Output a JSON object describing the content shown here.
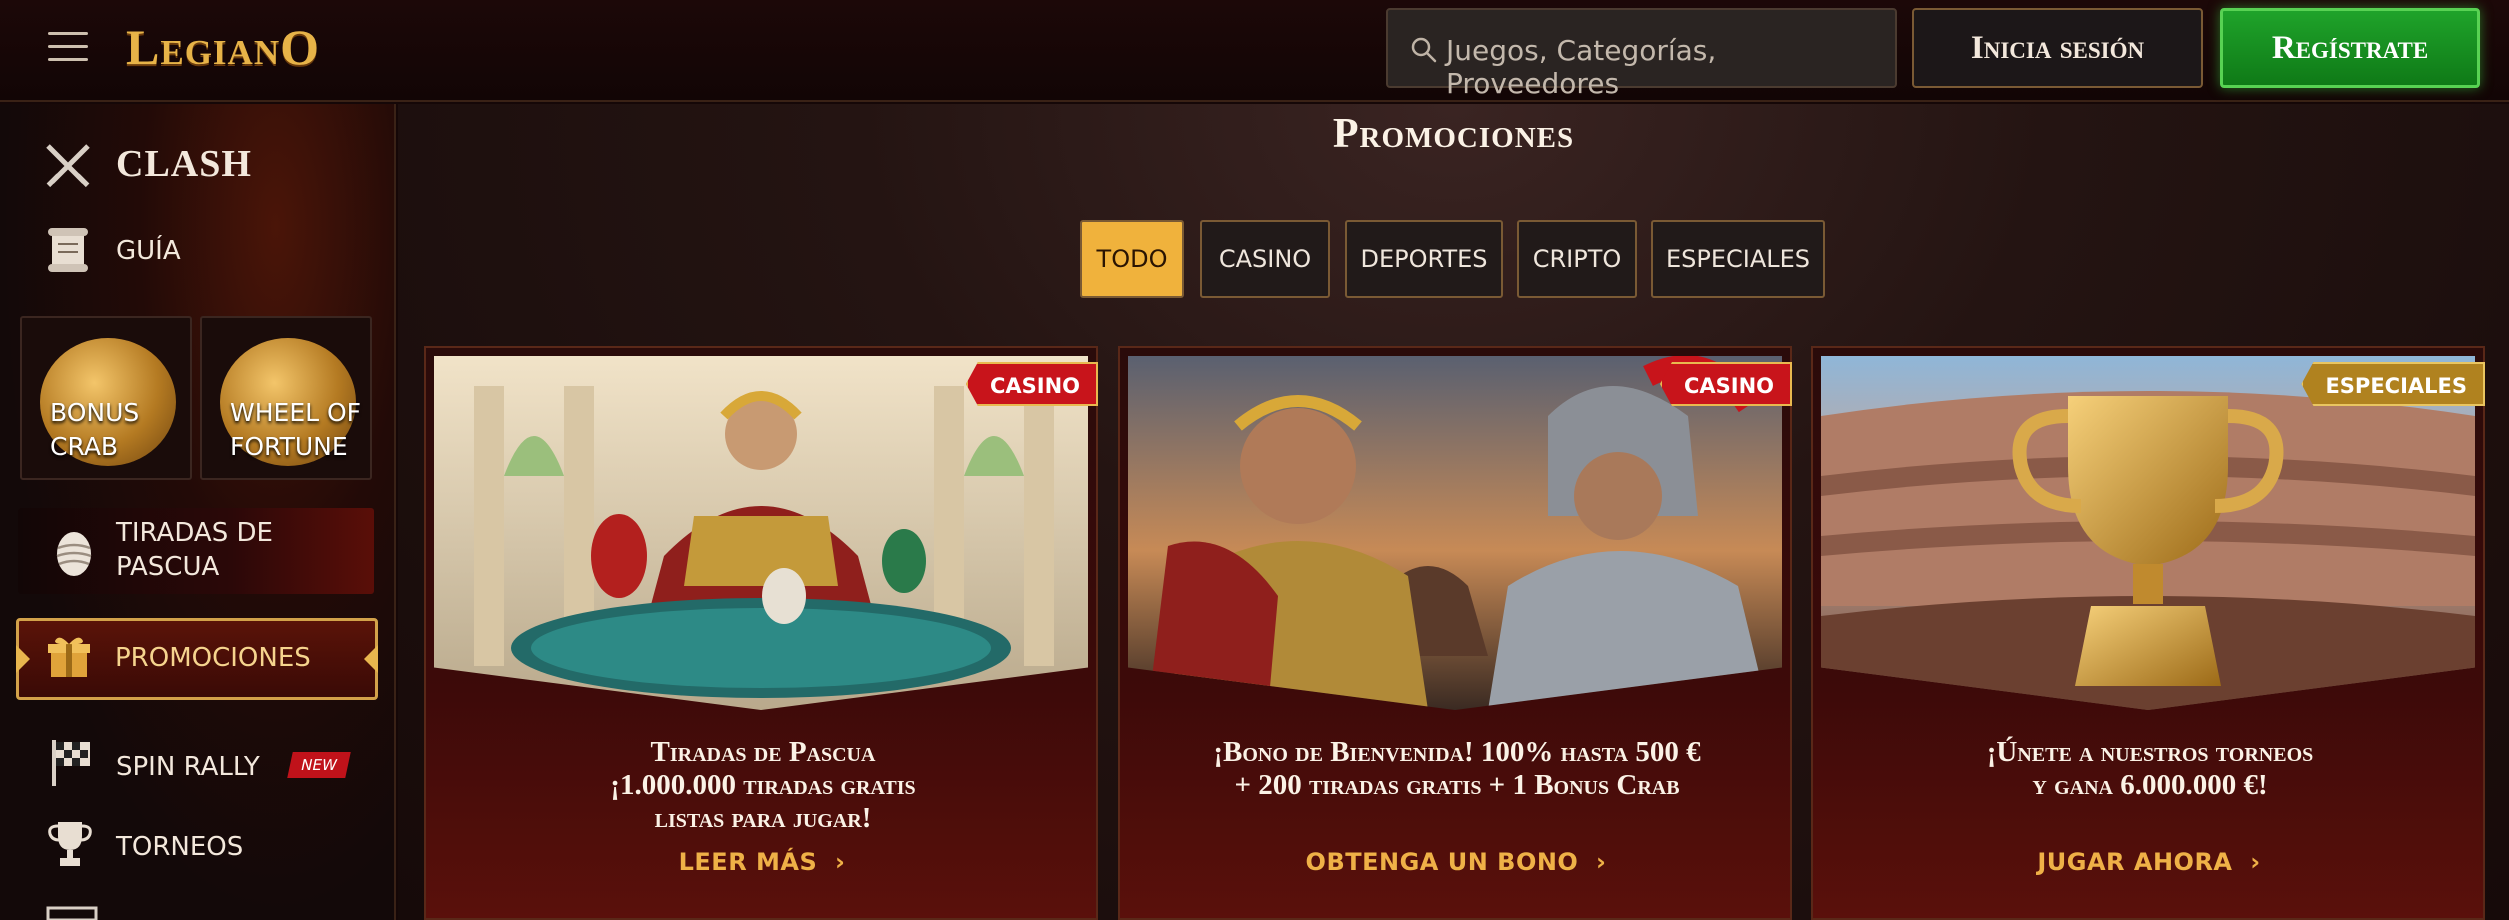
{
  "header": {
    "logo_text": "LegianO",
    "search_placeholder": "Juegos, Categorías, Proveedores",
    "login_label": "Inicia sesión",
    "register_label": "Regístrate"
  },
  "sidebar": {
    "clash_label": "CLASH",
    "guide_label": "GUÍA",
    "tiles": [
      {
        "label_line1": "BONUS",
        "label_line2": "CRAB"
      },
      {
        "label_line1": "WHEEL OF",
        "label_line2": "FORTUNE"
      }
    ],
    "easter_label_line1": "TIRADAS DE",
    "easter_label_line2": "PASCUA",
    "promos_label": "PROMOCIONES",
    "spin_rally_label": "SPIN RALLY",
    "new_badge": "NEW",
    "tournaments_label": "TORNEOS"
  },
  "main": {
    "title": "Promociones",
    "filters": [
      "TODO",
      "CASINO",
      "DEPORTES",
      "CRIPTO",
      "ESPECIALES"
    ],
    "active_filter": "TODO",
    "cards": [
      {
        "tag": "CASINO",
        "title_line1": "Tiradas de Pascua",
        "title_line2": "¡1.000.000 tiradas gratis",
        "title_line3": "listas para jugar!",
        "cta": "LEER MÁS"
      },
      {
        "tag": "CASINO",
        "title_line1": "¡Bono de Bienvenida! 100% hasta 500 €",
        "title_line2": "+ 200 tiradas gratis + 1 Bonus Crab",
        "title_line3": "",
        "cta": "OBTENGA UN BONO"
      },
      {
        "tag": "ESPECIALES",
        "title_line1": "¡Únete a nuestros torneos",
        "title_line2": "y gana 6.000.000 €!",
        "title_line3": "",
        "cta": "JUGAR AHORA"
      }
    ]
  },
  "colors": {
    "accent_gold": "#f0b23c",
    "register_green": "#1fa32a",
    "tag_red": "#c8141b",
    "background": "#150707"
  }
}
